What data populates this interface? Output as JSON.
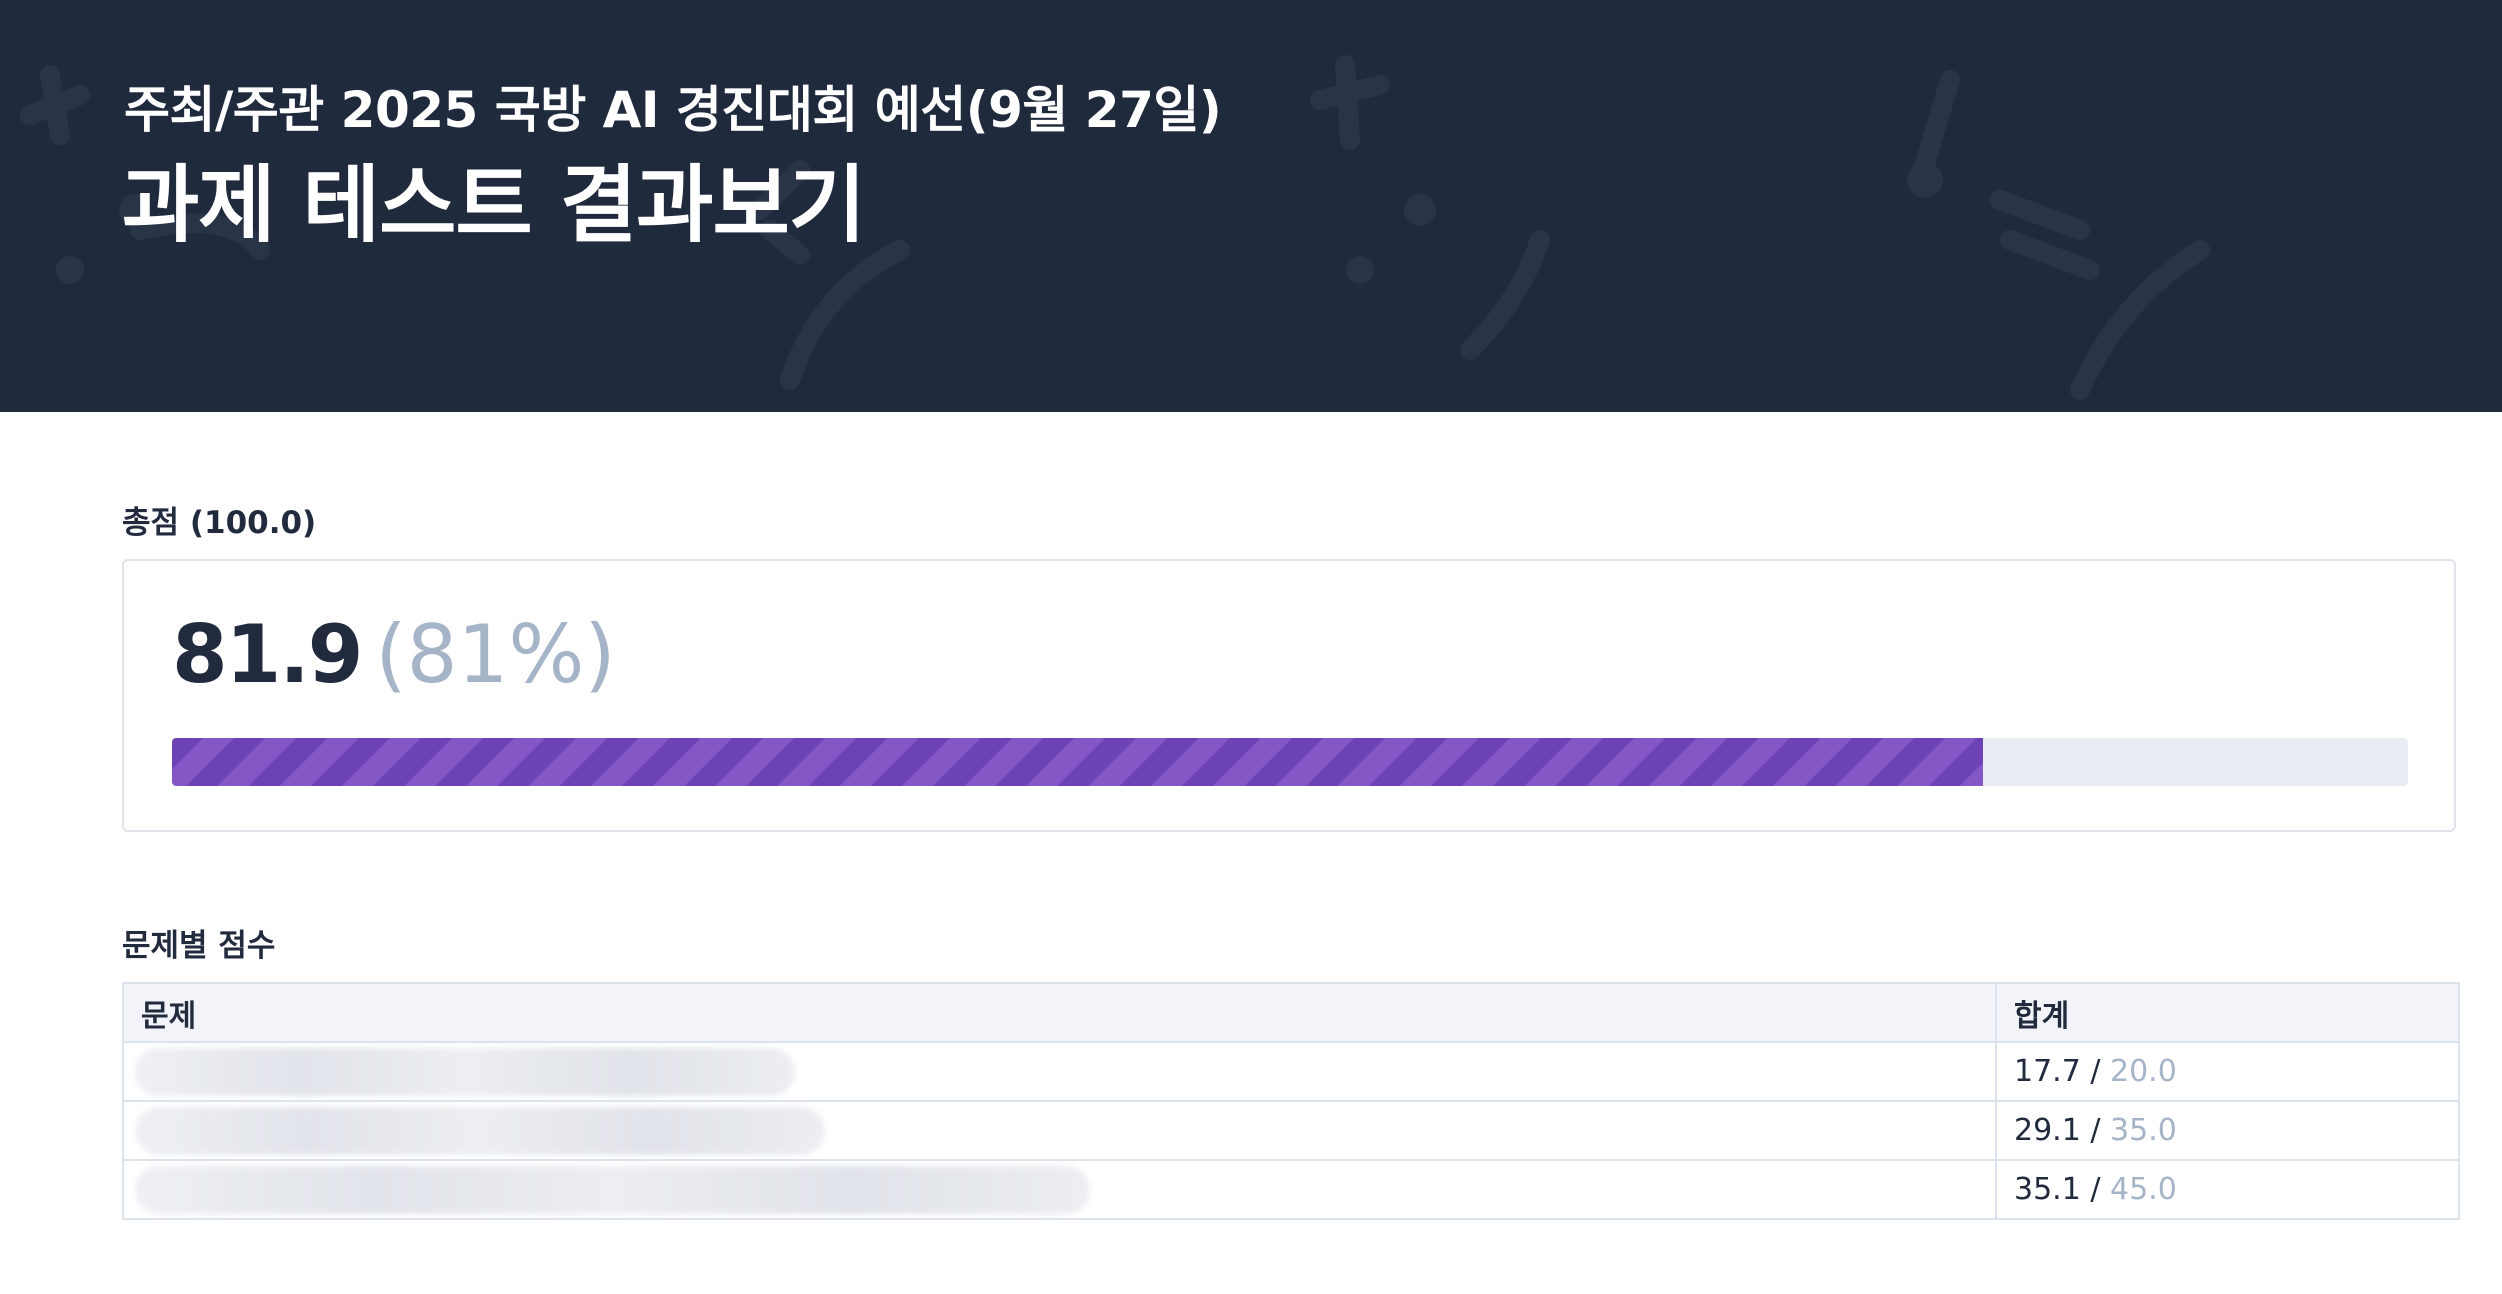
{
  "header": {
    "subtitle": "주최/주관 2025 국방 AI 경진대회 예선(9월 27일)",
    "title": "과제 테스트 결과보기",
    "background_color": "#202a3d"
  },
  "total": {
    "label": "총점 (100.0)",
    "score": "81.9",
    "percent": "(81%)",
    "progress_fraction": 0.81,
    "bar_color": "#6c42b4"
  },
  "per_problem": {
    "label": "문제별 점수",
    "columns": [
      "문제",
      "합계"
    ],
    "rows": [
      {
        "problem": "",
        "score": "17.7",
        "separator": "/",
        "max": "20.0"
      },
      {
        "problem": "",
        "score": "29.1",
        "separator": "/",
        "max": "35.0"
      },
      {
        "problem": "",
        "score": "35.1",
        "separator": "/",
        "max": "45.0"
      }
    ]
  }
}
